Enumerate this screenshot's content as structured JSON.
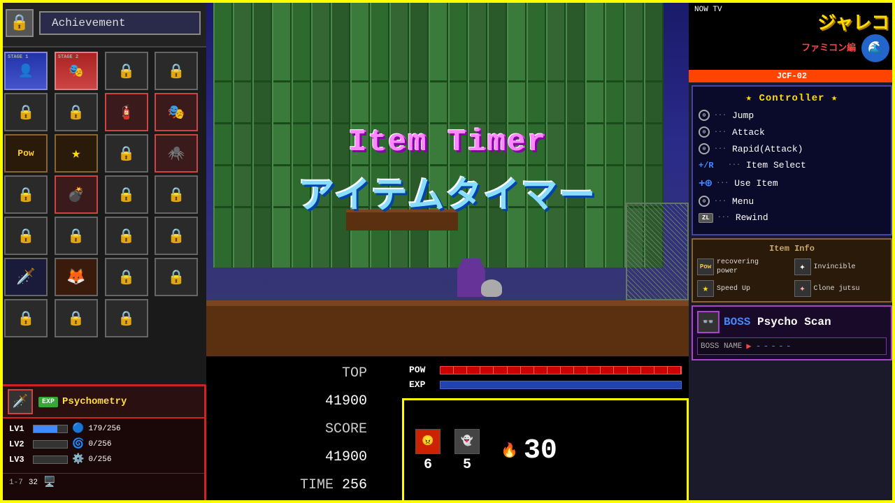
{
  "achievement": {
    "label": "Achievement"
  },
  "stages": [
    {
      "id": "stage1",
      "label": "STAGE 1",
      "type": "stage1",
      "locked": false
    },
    {
      "id": "stage2",
      "label": "STAGE 2",
      "type": "stage2",
      "locked": false
    },
    {
      "id": "s3",
      "label": "",
      "type": "locked",
      "locked": true
    },
    {
      "id": "s4",
      "label": "",
      "type": "locked",
      "locked": true
    },
    {
      "id": "s5",
      "label": "",
      "type": "locked",
      "locked": true
    },
    {
      "id": "s6",
      "label": "",
      "type": "locked",
      "locked": true
    },
    {
      "id": "s7",
      "label": "",
      "type": "red-item",
      "locked": false
    },
    {
      "id": "s8",
      "label": "",
      "type": "red-item",
      "locked": false
    },
    {
      "id": "s9",
      "label": "Pow",
      "type": "brown-item",
      "locked": false
    },
    {
      "id": "s10",
      "label": "★",
      "type": "brown-item",
      "locked": false
    },
    {
      "id": "s11",
      "label": "",
      "type": "locked",
      "locked": true
    },
    {
      "id": "s12",
      "label": "",
      "type": "red-item active",
      "locked": false
    },
    {
      "id": "s13",
      "label": "",
      "type": "locked",
      "locked": true
    },
    {
      "id": "s14",
      "label": "",
      "type": "red-item",
      "locked": false
    },
    {
      "id": "s15",
      "label": "",
      "type": "locked",
      "locked": true
    },
    {
      "id": "s16",
      "label": "",
      "type": "locked",
      "locked": true
    },
    {
      "id": "s17",
      "label": "",
      "type": "locked",
      "locked": true
    },
    {
      "id": "s18",
      "label": "",
      "type": "locked",
      "locked": true
    },
    {
      "id": "s19",
      "label": "",
      "type": "locked",
      "locked": true
    },
    {
      "id": "s20",
      "label": "",
      "type": "locked",
      "locked": true
    },
    {
      "id": "s21",
      "label": "",
      "type": "char1",
      "locked": false
    },
    {
      "id": "s22",
      "label": "",
      "type": "char2",
      "locked": false
    },
    {
      "id": "s23",
      "label": "",
      "type": "locked",
      "locked": true
    },
    {
      "id": "s24",
      "label": "",
      "type": "locked",
      "locked": true
    },
    {
      "id": "s25",
      "label": "",
      "type": "locked",
      "locked": true
    },
    {
      "id": "s26",
      "label": "",
      "type": "locked",
      "locked": true
    },
    {
      "id": "s27",
      "label": "",
      "type": "locked",
      "locked": true
    },
    {
      "id": "s28",
      "label": "",
      "type": "locked",
      "locked": true
    }
  ],
  "game": {
    "title_en": "Item Timer",
    "title_jp": "アイテムタイマー"
  },
  "score": {
    "top_label": "TOP",
    "top_value": "41900",
    "score_label": "SCORE",
    "score_value": "41900",
    "time_label": "TIME",
    "time_value": "256"
  },
  "pow": {
    "label": "POW",
    "exp_label": "EXP"
  },
  "inventory": {
    "count1": "6",
    "count2": "5",
    "lives": "30",
    "key_symbol": "⌂"
  },
  "exp_panel": {
    "badge": "EXP",
    "title": "Psychometry",
    "lv1_label": "LV1",
    "lv1_value": "179/256",
    "lv2_label": "LV2",
    "lv2_value": "0/256",
    "lv3_label": "LV3",
    "lv3_value": "0/256",
    "status_id": "1-7",
    "status_num": "32"
  },
  "right_panel": {
    "now_tv": "NOW TV",
    "jaleco_jp": "ジャレコ",
    "jaleco_sub": "ファミコン編",
    "jcf_label": "JCF-02",
    "controller_title": "★ Controller ★",
    "controls": [
      {
        "btn": "⊙",
        "dots": "···",
        "action": "Jump"
      },
      {
        "btn": "⊙",
        "dots": "···",
        "action": "Attack"
      },
      {
        "btn": "⊙",
        "dots": "···",
        "action": "Rapid(Attack)"
      },
      {
        "btn": "+/R",
        "dots": "···",
        "action": "Item Select"
      },
      {
        "btn": "+⊕",
        "dots": "···",
        "action": "Use Item"
      },
      {
        "btn": "⊙",
        "dots": "···",
        "action": "Menu"
      },
      {
        "btn": "ZL",
        "dots": "···",
        "action": "Rewind"
      }
    ],
    "item_info_title": "Item Info",
    "items": [
      {
        "icon": "Pow",
        "text": "recovering\npower"
      },
      {
        "icon": "★",
        "text": "Speed Up"
      },
      {
        "icon": "✦",
        "text": "Invincible"
      },
      {
        "icon": "✦",
        "text": "Clone jutsu"
      }
    ],
    "boss_label": "BOSS",
    "boss_scan": "Psycho Scan",
    "boss_name_label": "BOSS NAME",
    "boss_name_value": "-----"
  }
}
